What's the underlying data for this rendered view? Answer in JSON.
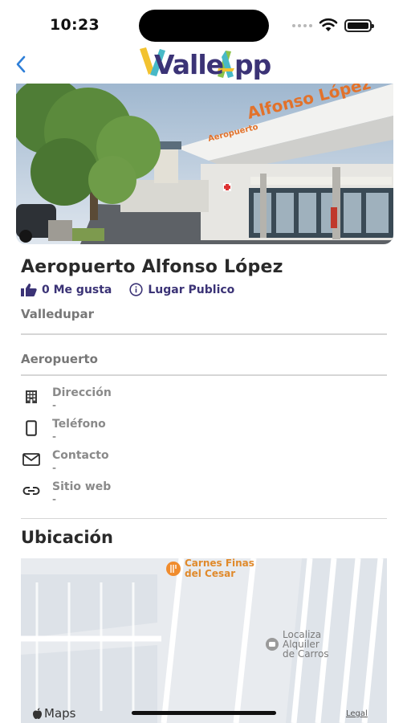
{
  "status_bar": {
    "time": "10:23"
  },
  "header": {
    "back_icon": "chevron-left-icon",
    "logo_text_left": "Valle",
    "logo_text_right": "pp",
    "logo_colors": [
      "#f2c230",
      "#48b9c7",
      "#8bc34a",
      "#3b3376"
    ]
  },
  "hero": {
    "sign_text": "Alfonso López",
    "sign_text_small": "Aeropuerto"
  },
  "place": {
    "title": "Aeropuerto Alfonso López",
    "likes": "0 Me gusta",
    "likes_icon": "thumbs-up-icon",
    "type": "Lugar Publico",
    "type_icon": "info-circle-icon",
    "city": "Valledupar",
    "category": "Aeropuerto"
  },
  "info": [
    {
      "icon": "building-icon",
      "label": "Dirección",
      "value": "-"
    },
    {
      "icon": "phone-icon",
      "label": "Teléfono",
      "value": "-"
    },
    {
      "icon": "mail-icon",
      "label": "Contacto",
      "value": "-"
    },
    {
      "icon": "link-icon",
      "label": "Sitio web",
      "value": "-"
    }
  ],
  "location": {
    "title": "Ubicación",
    "poi_restaurant_line1": "Carnes Finas",
    "poi_restaurant_line2": "del Cesar",
    "poi_rental_line1": "Localiza",
    "poi_rental_line2": "Alquiler",
    "poi_rental_line3": "de Carros",
    "brand": "Maps",
    "legal": "Legal"
  },
  "colors": {
    "accent": "#3b3376",
    "poi_orange": "#e08a2c"
  }
}
